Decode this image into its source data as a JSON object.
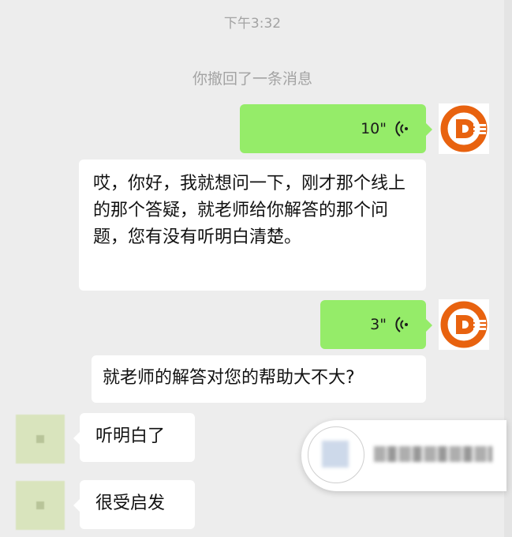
{
  "chat": {
    "timestamp": "下午3:32",
    "system_notice": "你撤回了一条消息",
    "messages": [
      {
        "side": "right",
        "type": "voice",
        "duration": "10\""
      },
      {
        "side": "left",
        "type": "text",
        "text": "哎，你好，我就想问一下，刚才那个线上的那个答疑，就老师给你解答的那个问题，您有没有听明白清楚。"
      },
      {
        "side": "right",
        "type": "voice",
        "duration": "3\""
      },
      {
        "side": "left",
        "type": "text",
        "text": "就老师的解答对您的帮助大不大?"
      },
      {
        "side": "left",
        "type": "text",
        "text": "听明白了"
      },
      {
        "side": "left",
        "type": "text",
        "text": "很受启发"
      }
    ]
  },
  "colors": {
    "background": "#ededed",
    "self_bubble": "#95ec69",
    "other_bubble": "#ffffff",
    "logo_orange": "#e8620f"
  },
  "icons": {
    "voice": "voice-wave-icon",
    "logo": "orange-d-logo-icon"
  }
}
